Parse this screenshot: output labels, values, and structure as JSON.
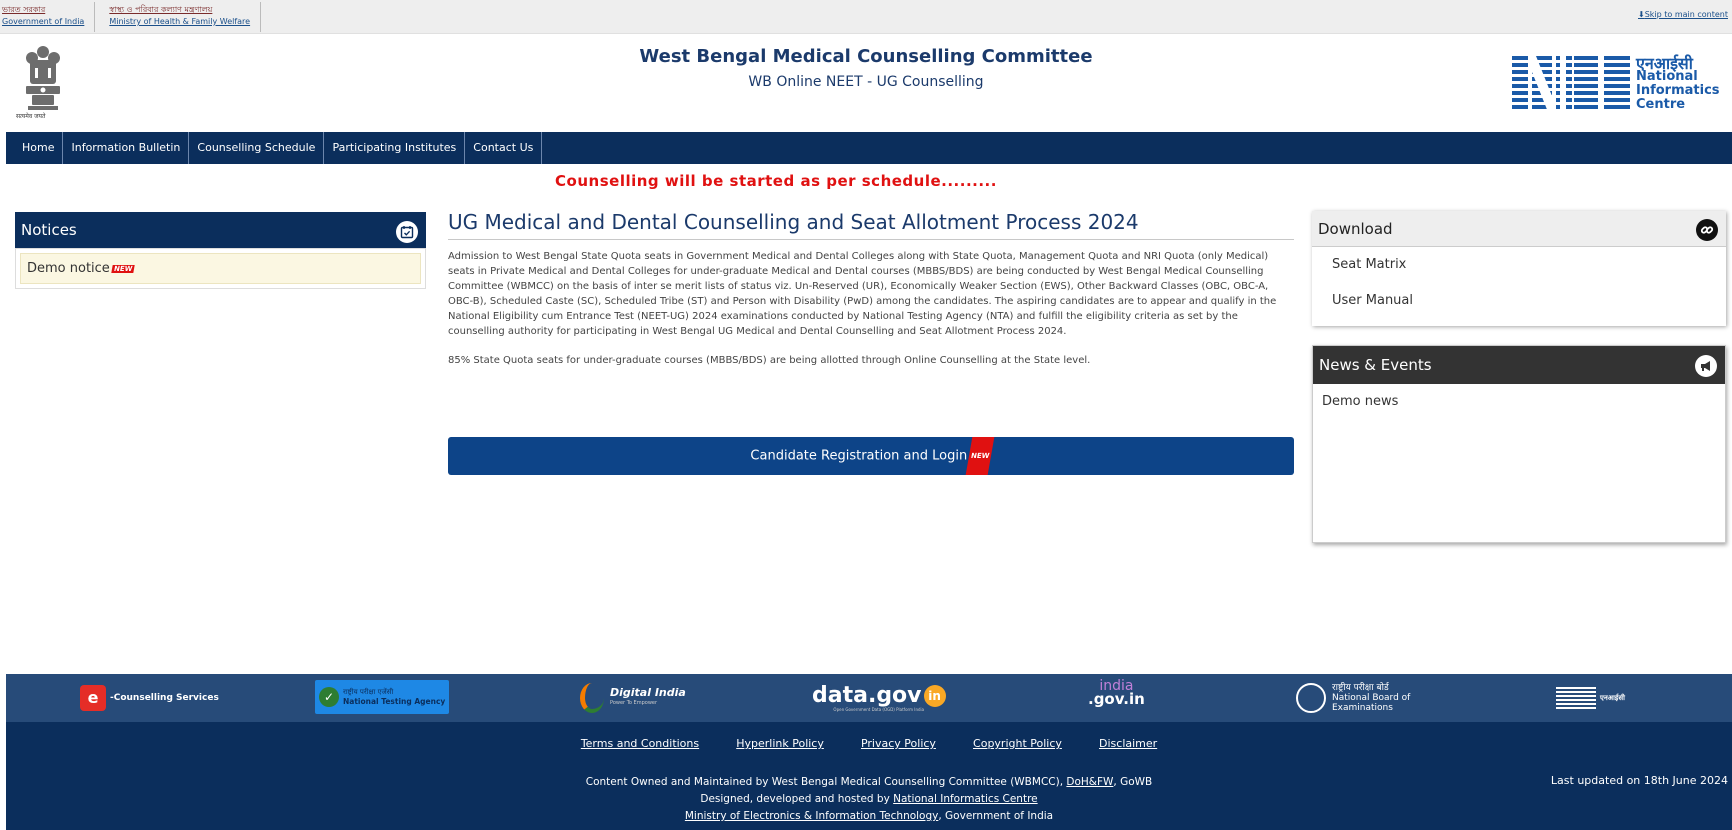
{
  "govbar": {
    "gov_bn": "ভারত সরকার",
    "gov_en": "Government of India",
    "ministry_bn": "স্বাস্থ্য ও পরিবার কল্যাণ মন্ত্রণালয়",
    "ministry_en": "Ministry of Health & Family Welfare",
    "skip": "Skip to main content"
  },
  "header": {
    "title": "West Bengal Medical Counselling Committee",
    "subtitle": "WB Online NEET - UG Counselling",
    "emblem_caption": "सत्यमेव जयते",
    "nic_hindi": "एनआईसी",
    "nic_line1": "National",
    "nic_line2": "Informatics",
    "nic_line3": "Centre"
  },
  "nav": {
    "items": [
      "Home",
      "Information Bulletin",
      "Counselling Schedule",
      "Participating Institutes",
      "Contact Us"
    ]
  },
  "marquee": "Counselling will be started as per schedule.........",
  "notices": {
    "title": "Notices",
    "items": [
      "Demo notice"
    ],
    "new_badge": "NEW"
  },
  "main": {
    "heading": "UG Medical and Dental Counselling and Seat Allotment Process 2024",
    "para1": "Admission to West Bengal State Quota seats in Government Medical and Dental Colleges along with State Quota, Management Quota and NRI Quota (only Medical) seats in Private Medical and Dental Colleges for under-graduate Medical and Dental courses (MBBS/BDS) are being conducted by West Bengal Medical Counselling Committee (WBMCC) on the basis of inter se merit lists of status viz. Un-Reserved (UR), Economically Weaker Section (EWS), Other Backward Classes (OBC, OBC-A, OBC-B), Scheduled Caste (SC), Scheduled Tribe (ST) and Person with Disability (PwD) among the candidates. The aspiring candidates are to appear and qualify in the National Eligibility cum Entrance Test (NEET-UG) 2024 examinations conducted by National Testing Agency (NTA) and fulfill the eligibility criteria as set by the counselling authority for participating in West Bengal UG Medical and Dental Counselling and Seat Allotment Process 2024.",
    "para2": "85% State Quota seats for under-graduate courses (MBBS/BDS) are being allotted through Online Counselling at the State level.",
    "cta": "Candidate Registration and Login"
  },
  "download": {
    "title": "Download",
    "items": [
      "Seat Matrix",
      "User Manual"
    ]
  },
  "news": {
    "title": "News & Events",
    "items": [
      "Demo news"
    ]
  },
  "footer": {
    "logos": {
      "ecounselling": "Counselling Services",
      "nta_hindi": "राष्ट्रीय परीक्षा एजेंसी",
      "nta_en": "National Testing Agency",
      "digital_india": "Digital India",
      "digital_india_tag": "Power To Empower",
      "datagov": "data.gov",
      "datagov_tag": "Open Government Data (OGD) Platform India",
      "indiagov_top": "india",
      "indiagov_bottom": ".gov.in",
      "nbe_hindi": "राष्ट्रीय परीक्षा बोर्ड",
      "nbe_en1": "National Board of",
      "nbe_en2": "Examinations",
      "nic_small": "एनआईसी"
    },
    "links": [
      "Terms and Conditions",
      "Hyperlink Policy",
      "Privacy Policy",
      "Copyright Policy",
      "Disclaimer"
    ],
    "credit1_pre": "Content Owned and Maintained by West Bengal Medical Counselling Committee (WBMCC), ",
    "credit1_link": "DoH&FW",
    "credit1_post": ", GoWB",
    "credit2_pre": "Designed, developed and hosted by ",
    "credit2_link": "National Informatics Centre",
    "credit3_link": "Ministry of Electronics & Information Technology",
    "credit3_post": ", Government of India",
    "updated": "Last updated on 18th June 2024"
  },
  "colors": {
    "navy": "#0b2e5c",
    "footer_logo_band": "#274b79",
    "accent_red": "#e01111",
    "cta_blue": "#0d4488"
  }
}
